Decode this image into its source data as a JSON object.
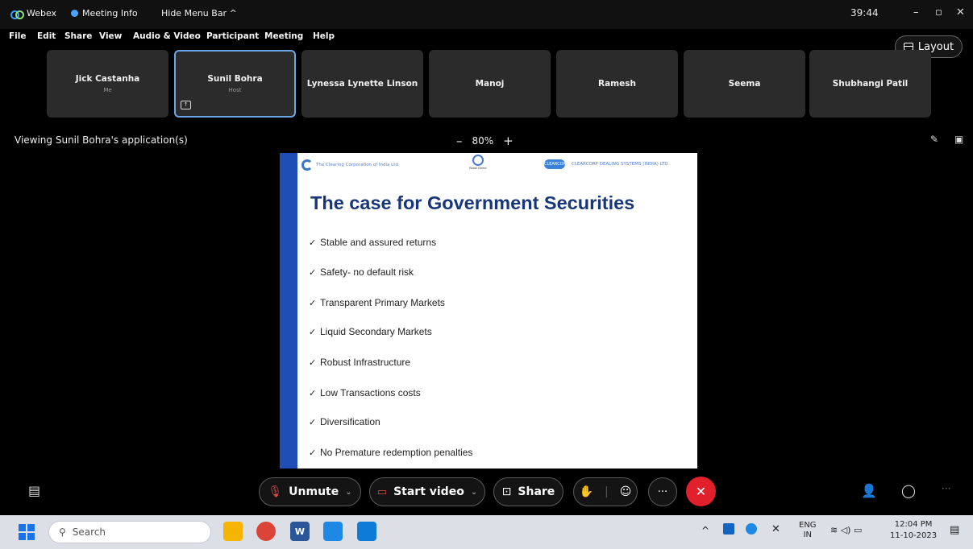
{
  "topbar": {
    "app_name": "Webex",
    "meeting_info": "Meeting Info",
    "hide_menu_bar": "Hide Menu Bar ^",
    "timer": "39:44",
    "minimize": "–",
    "restore": "▫",
    "close": "✕"
  },
  "menu": [
    "File",
    "Edit",
    "Share",
    "View",
    "Audio & Video",
    "Participant",
    "Meeting",
    "Help"
  ],
  "layout_label": "Layout",
  "participants": [
    {
      "name": "Jick Castanha",
      "role": "Me"
    },
    {
      "name": "Sunil Bohra",
      "role": "Host"
    },
    {
      "name": "Lynessa Lynette Linson",
      "role": ""
    },
    {
      "name": "Manoj",
      "role": ""
    },
    {
      "name": "Ramesh",
      "role": ""
    },
    {
      "name": "Seema",
      "role": ""
    },
    {
      "name": "Shubhangi Patil",
      "role": ""
    }
  ],
  "viewing_label": "Viewing Sunil Bohra's application(s)",
  "zoom": {
    "minus": "–",
    "value": "80%",
    "plus": "+"
  },
  "slide": {
    "brand_left": "The Clearing Corporation of India Ltd.",
    "brand_mid": "Retail Direct",
    "brand_right_logo": "CLEARCORP",
    "brand_right": "CLEARCORP DEALING SYSTEMS (INDIA) LTD.",
    "title": "The case for Government Securities",
    "bullets": [
      "Stable and assured returns",
      "Safety- no default risk",
      "Transparent Primary Markets",
      "Liquid Secondary Markets",
      "Robust Infrastructure",
      "Low Transactions costs",
      "Diversification",
      "No Premature redemption penalties"
    ],
    "check": "✓"
  },
  "controls": {
    "unmute": "Unmute",
    "start_video": "Start video",
    "share": "Share",
    "more": "···",
    "end": "✕"
  },
  "taskbar": {
    "search_placeholder": "Search",
    "lang_1": "ENG",
    "lang_2": "IN",
    "time": "12:04 PM",
    "date": "11-10-2023"
  },
  "colors": {
    "end_call": "#e0202a",
    "active_tile_border": "#6aa6e6",
    "slide_title": "#18367a",
    "slide_edge": "#1f4fb6"
  }
}
